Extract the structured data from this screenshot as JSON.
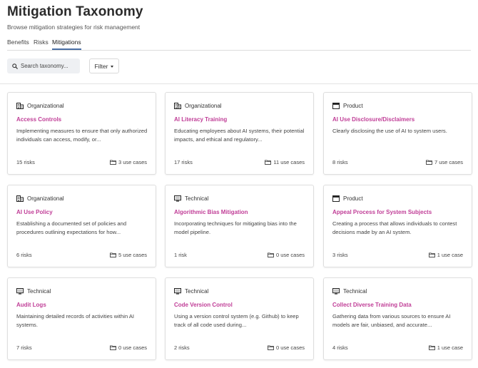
{
  "header": {
    "title": "Mitigation Taxonomy",
    "subtitle": "Browse mitigation strategies for risk management"
  },
  "tabs": [
    {
      "label": "Benefits",
      "active": false
    },
    {
      "label": "Risks",
      "active": false
    },
    {
      "label": "Mitigations",
      "active": true
    }
  ],
  "search": {
    "placeholder": "Search taxonomy..."
  },
  "filter": {
    "label": "Filter"
  },
  "colors": {
    "accent": "#c03e97",
    "tab_indicator": "#4a6fa5"
  },
  "cards": [
    {
      "type": "Organizational",
      "type_icon": "building-icon",
      "title": "Access Controls",
      "description": "Implementing measures to ensure that only authorized individuals can access, modify, or...",
      "risks": "15 risks",
      "use_cases": "3 use cases"
    },
    {
      "type": "Organizational",
      "type_icon": "building-icon",
      "title": "AI Literacy Training",
      "description": "Educating employees about AI systems, their potential impacts, and ethical and regulatory...",
      "risks": "17 risks",
      "use_cases": "11 use cases"
    },
    {
      "type": "Product",
      "type_icon": "window-icon",
      "title": "AI Use Disclosure/Disclaimers",
      "description": "Clearly disclosing the use of AI to system users.",
      "risks": "8 risks",
      "use_cases": "7 use cases"
    },
    {
      "type": "Organizational",
      "type_icon": "building-icon",
      "title": "AI Use Policy",
      "description": "Establishing a documented set of policies and procedures outlining expectations for how...",
      "risks": "6 risks",
      "use_cases": "5 use cases"
    },
    {
      "type": "Technical",
      "type_icon": "monitor-icon",
      "title": "Algorithmic Bias Mitigation",
      "description": "Incorporating techniques for mitigating bias into the model pipeline.",
      "risks": "1 risk",
      "use_cases": "0 use cases"
    },
    {
      "type": "Product",
      "type_icon": "window-icon",
      "title": "Appeal Process for System Subjects",
      "description": "Creating a process that allows individuals to contest decisions made by an AI system.",
      "risks": "3 risks",
      "use_cases": "1 use case"
    },
    {
      "type": "Technical",
      "type_icon": "monitor-icon",
      "title": "Audit Logs",
      "description": "Maintaining detailed records of activities within AI systems.",
      "risks": "7 risks",
      "use_cases": "0 use cases"
    },
    {
      "type": "Technical",
      "type_icon": "monitor-icon",
      "title": "Code Version Control",
      "description": "Using a version control system (e.g. Github) to keep track of all code used during...",
      "risks": "2 risks",
      "use_cases": "0 use cases"
    },
    {
      "type": "Technical",
      "type_icon": "monitor-icon",
      "title": "Collect Diverse Training Data",
      "description": "Gathering data from various sources to ensure AI models are fair, unbiased, and accurate...",
      "risks": "4 risks",
      "use_cases": "1 use case"
    }
  ]
}
